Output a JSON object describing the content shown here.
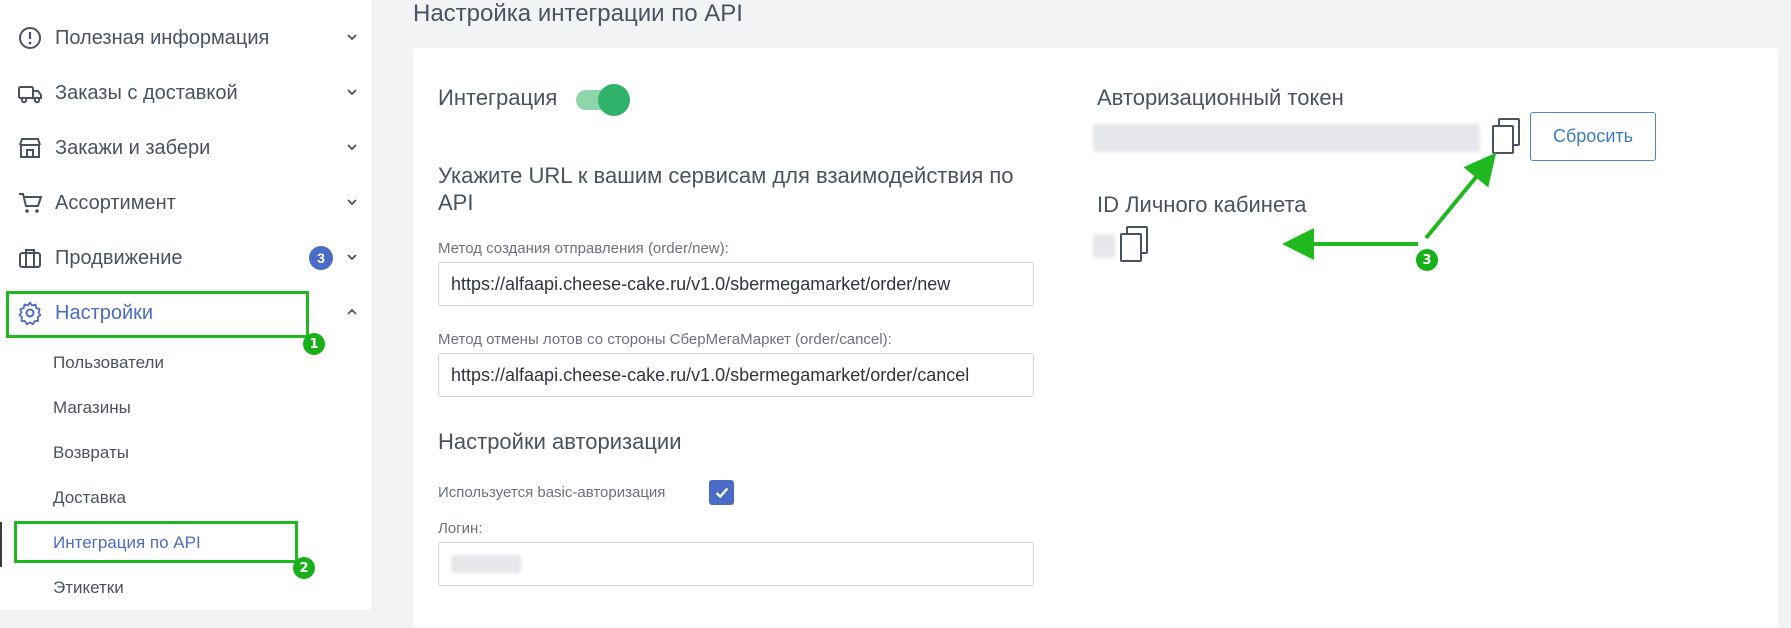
{
  "sidebar": {
    "items": [
      {
        "label": "Полезная информация",
        "icon": "info-icon"
      },
      {
        "label": "Заказы с доставкой",
        "icon": "truck-icon"
      },
      {
        "label": "Закажи и забери",
        "icon": "store-icon"
      },
      {
        "label": "Ассортимент",
        "icon": "cart-icon"
      },
      {
        "label": "Продвижение",
        "icon": "briefcase-icon",
        "badge": "3"
      },
      {
        "label": "Настройки",
        "icon": "gear-icon",
        "active": true
      }
    ],
    "subitems": [
      {
        "label": "Пользователи"
      },
      {
        "label": "Магазины"
      },
      {
        "label": "Возвраты"
      },
      {
        "label": "Доставка"
      },
      {
        "label": "Интеграция по API",
        "active": true
      },
      {
        "label": "Этикетки"
      }
    ]
  },
  "page": {
    "title": "Настройка интеграции по API"
  },
  "integration": {
    "label": "Интеграция",
    "enabled": true
  },
  "urls": {
    "heading": "Укажите URL к вашим сервисам для взаимодействия по API",
    "order_new_label": "Метод создания отправления (order/new):",
    "order_new_value": "https://alfaapi.cheese-cake.ru/v1.0/sbermegamarket/order/new",
    "order_cancel_label": "Метод отмены лотов со стороны СберМегаМаркет (order/cancel):",
    "order_cancel_value": "https://alfaapi.cheese-cake.ru/v1.0/sbermegamarket/order/cancel"
  },
  "auth": {
    "heading": "Настройки авторизации",
    "basic_label": "Используется basic-авторизация",
    "basic_checked": true,
    "login_label": "Логин:"
  },
  "token": {
    "heading": "Авторизационный токен",
    "reset_label": "Сбросить"
  },
  "account": {
    "heading": "ID Личного кабинета"
  },
  "annotations": {
    "marker1": "1",
    "marker2": "2",
    "marker3": "3"
  },
  "colors": {
    "accent": "#4b6cc4",
    "annotation_green": "#1fb81f",
    "toggle_on": "#2fb36a"
  }
}
